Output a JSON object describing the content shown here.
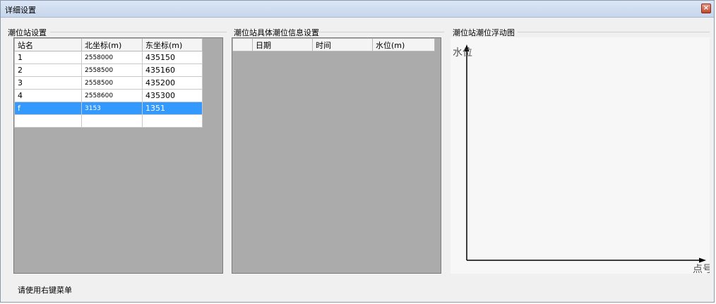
{
  "window": {
    "title": "详细设置"
  },
  "stations": {
    "title": "潮位站设置",
    "columns": [
      "站名",
      "北坐标(m)",
      "东坐标(m)"
    ],
    "rows": [
      [
        "1",
        "2558000",
        "435150"
      ],
      [
        "2",
        "2558500",
        "435160"
      ],
      [
        "3",
        "2558500",
        "435200"
      ],
      [
        "4",
        "2558600",
        "435300"
      ],
      [
        "f",
        "3153",
        "1351"
      ],
      [
        "",
        "",
        ""
      ]
    ],
    "selected_row": 4
  },
  "tide_info": {
    "title": "潮位站具体潮位信息设置",
    "columns": [
      "",
      "日期",
      "时间",
      "水位(m)"
    ]
  },
  "chart": {
    "title": "潮位站潮位浮动图",
    "y_label": "水位",
    "x_label": "点号"
  },
  "status": {
    "hint": "请使用右键菜单"
  }
}
